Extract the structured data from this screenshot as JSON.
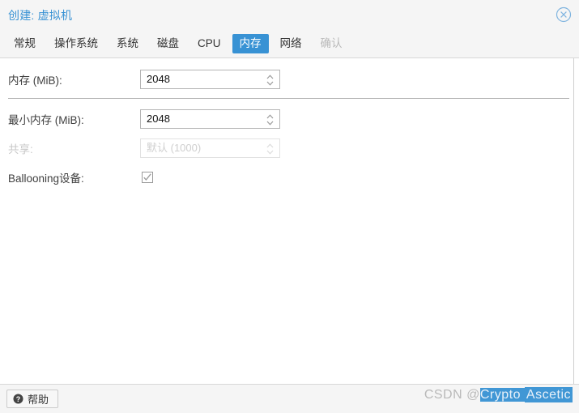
{
  "window": {
    "title": "创建: 虚拟机",
    "close_icon": "close-circle-icon"
  },
  "tabs": [
    {
      "label": "常规",
      "state": "normal"
    },
    {
      "label": "操作系统",
      "state": "normal"
    },
    {
      "label": "系统",
      "state": "normal"
    },
    {
      "label": "磁盘",
      "state": "normal"
    },
    {
      "label": "CPU",
      "state": "normal"
    },
    {
      "label": "内存",
      "state": "active"
    },
    {
      "label": "网络",
      "state": "normal"
    },
    {
      "label": "确认",
      "state": "disabled"
    }
  ],
  "form": {
    "memory": {
      "label": "内存 (MiB):",
      "value": "2048",
      "spinner_icon": "spinner-up-down-icon"
    },
    "min_memory": {
      "label": "最小内存 (MiB):",
      "value": "2048",
      "spinner_icon": "spinner-up-down-icon"
    },
    "shares": {
      "label": "共享:",
      "value": "默认 (1000)",
      "placeholder": "默认 (1000)",
      "spinner_icon": "spinner-up-down-icon",
      "disabled": "true"
    },
    "ballooning": {
      "label": "Ballooning设备:",
      "checked": "true",
      "check_icon": "checkmark-icon"
    }
  },
  "footer": {
    "help_label": "帮助",
    "help_icon": "question-circle-icon"
  },
  "watermark": {
    "prefix": "CSDN @",
    "selected": "Crypto ",
    "boxed": "Ascetic"
  },
  "colors": {
    "accent": "#3892d4",
    "title_bg": "#f5f5f5",
    "text": "#333333",
    "muted": "#c8c8c8",
    "border": "#cfcfcf"
  }
}
